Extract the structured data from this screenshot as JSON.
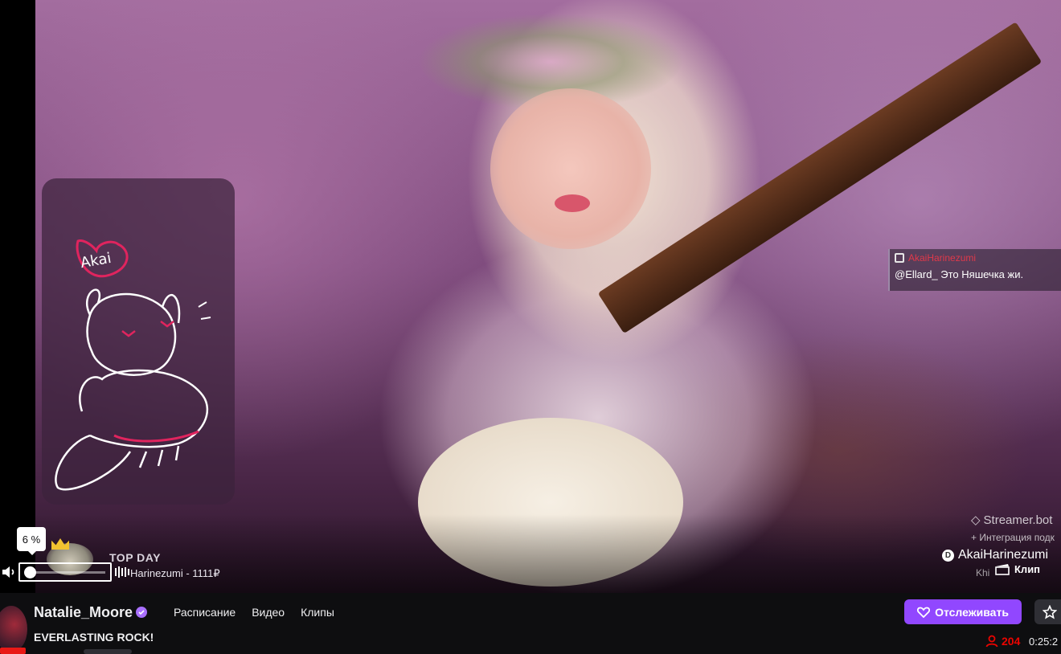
{
  "player": {
    "overlay_chat": {
      "username": "AkaiHarinezumi",
      "message": "@Ellard_ Это Няшечка жи."
    },
    "sticker_text": "Akai",
    "top_day": {
      "title": "TOP DAY",
      "line": "Harinezumi - 1111₽"
    },
    "streamer_bot": {
      "logo": "Streamer.bot",
      "sub": "+ Интеграция подк"
    },
    "brand": {
      "name": "AkaiHarinezumi",
      "sub": "Khi"
    },
    "volume": {
      "tooltip": "6 %",
      "level_percent": 6
    },
    "clip_label": "Клип"
  },
  "channel": {
    "name": "Natalie_Moore",
    "nav": [
      "Расписание",
      "Видео",
      "Клипы"
    ],
    "stream_title": "EVERLASTING ROCK!",
    "follow_label": "Отслеживать",
    "viewers": "204",
    "uptime": "0:25:2"
  },
  "colors": {
    "accent": "#9147ff",
    "live_red": "#eb0400"
  }
}
